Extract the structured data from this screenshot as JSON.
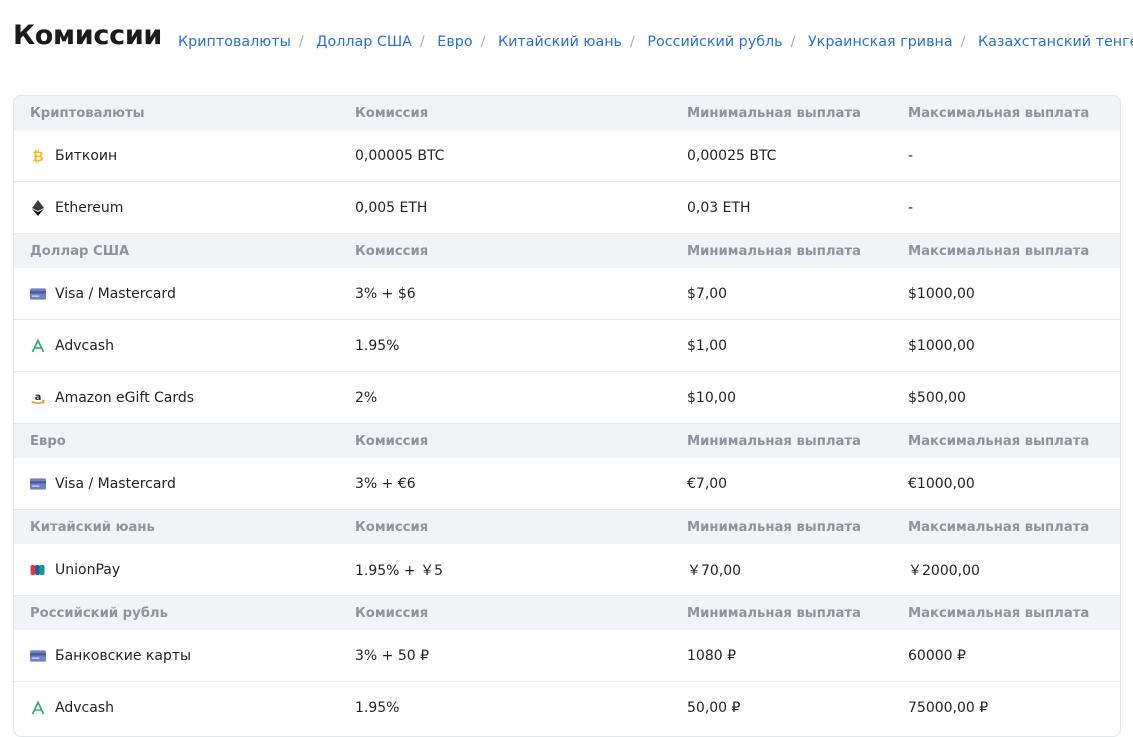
{
  "page": {
    "title": "Комиссии",
    "nav": [
      "Криптовалюты",
      "Доллар США",
      "Евро",
      "Китайский юань",
      "Российский рубль",
      "Украинская гривна",
      "Казахстанский тенге"
    ]
  },
  "columns": {
    "commission": "Комиссия",
    "min": "Минимальная выплата",
    "max": "Максимальная выплата"
  },
  "sections": [
    {
      "title": "Криптовалюты",
      "rows": [
        {
          "icon": "bitcoin-icon",
          "name": "Биткоин",
          "commission": "0,00005 BTC",
          "min": "0,00025 BTC",
          "max": "-"
        },
        {
          "icon": "ethereum-icon",
          "name": "Ethereum",
          "commission": "0,005 ETH",
          "min": "0,03 ETH",
          "max": "-"
        }
      ]
    },
    {
      "title": "Доллар США",
      "rows": [
        {
          "icon": "card-icon",
          "name": "Visa / Mastercard",
          "commission": "3% + $6",
          "min": "$7,00",
          "max": "$1000,00"
        },
        {
          "icon": "advcash-icon",
          "name": "Advcash",
          "commission": "1.95%",
          "min": "$1,00",
          "max": "$1000,00"
        },
        {
          "icon": "amazon-icon",
          "name": "Amazon eGift Cards",
          "commission": "2%",
          "min": "$10,00",
          "max": "$500,00"
        }
      ]
    },
    {
      "title": "Евро",
      "rows": [
        {
          "icon": "card-icon",
          "name": "Visa / Mastercard",
          "commission": "3% + €6",
          "min": "€7,00",
          "max": "€1000,00"
        }
      ]
    },
    {
      "title": "Китайский юань",
      "rows": [
        {
          "icon": "unionpay-icon",
          "name": "UnionPay",
          "commission": "1.95% + ￥5",
          "min": "￥70,00",
          "max": "￥2000,00"
        }
      ]
    },
    {
      "title": "Российский рубль",
      "rows": [
        {
          "icon": "card-icon",
          "name": "Банковские карты",
          "commission": "3% + 50 ₽",
          "min": "1080 ₽",
          "max": "60000 ₽"
        },
        {
          "icon": "advcash-icon",
          "name": "Advcash",
          "commission": "1.95%",
          "min": "50,00 ₽",
          "max": "75000,00 ₽"
        }
      ]
    }
  ],
  "colors": {
    "link": "#2a6fcf",
    "header_bg": "#f2f3f6",
    "header_text": "#8e939c",
    "bitcoin": "#f7b924",
    "advcash": "#3aa874",
    "amazon": "#f39a1d",
    "card": "#7080c0"
  }
}
